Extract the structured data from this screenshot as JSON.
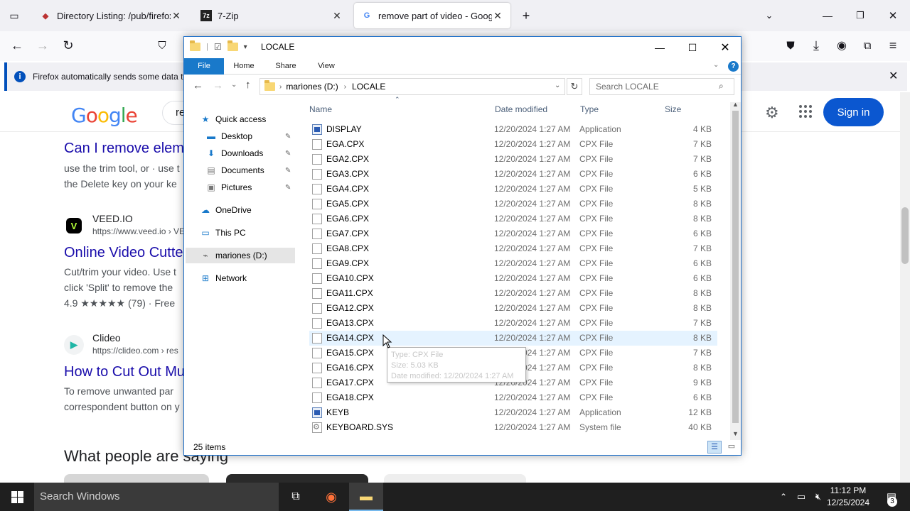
{
  "browser": {
    "tabs": [
      {
        "label": "Directory Listing: /pub/firefox/r",
        "active": false
      },
      {
        "label": "7-Zip",
        "active": false
      },
      {
        "label": "remove part of video - Google S",
        "active": true
      }
    ],
    "notice": "Firefox automatically sends some data to"
  },
  "google": {
    "logo": "Google",
    "search_fragment": "re",
    "sign_in": "Sign in",
    "results": [
      {
        "title": "Can I remove elem",
        "snippet_1": "use the trim tool, or · use t",
        "snippet_2": "the Delete key on your ke"
      },
      {
        "site": "VEED.IO",
        "url": "https://www.veed.io › VE",
        "title": "Online Video Cutte",
        "snippet_1": "Cut/trim your video. Use t",
        "snippet_2": "click 'Split' to remove the",
        "rating": "4.9 ★★★★★ (79) · Free"
      },
      {
        "site": "Clideo",
        "url": "https://clideo.com › res",
        "title": "How to Cut Out Mu",
        "snippet_1": "To remove unwanted par",
        "snippet_2": "correspondent button on y"
      }
    ],
    "people_also": "What people are saying"
  },
  "explorer": {
    "title": "LOCALE",
    "ribbon_tabs": [
      "File",
      "Home",
      "Share",
      "View"
    ],
    "path": [
      "marìones (D:)",
      "LOCALE"
    ],
    "search_placeholder": "Search LOCALE",
    "nav": {
      "quick_access": "Quick access",
      "desktop": "Desktop",
      "downloads": "Downloads",
      "documents": "Documents",
      "pictures": "Pictures",
      "onedrive": "OneDrive",
      "thispc": "This PC",
      "drive": "mariones (D:)",
      "network": "Network"
    },
    "columns": {
      "name": "Name",
      "date": "Date modified",
      "type": "Type",
      "size": "Size"
    },
    "files": [
      {
        "name": "DISPLAY",
        "date": "12/20/2024 1:27 AM",
        "type": "Application",
        "size": "4 KB"
      },
      {
        "name": "EGA.CPX",
        "date": "12/20/2024 1:27 AM",
        "type": "CPX File",
        "size": "7 KB"
      },
      {
        "name": "EGA2.CPX",
        "date": "12/20/2024 1:27 AM",
        "type": "CPX File",
        "size": "7 KB"
      },
      {
        "name": "EGA3.CPX",
        "date": "12/20/2024 1:27 AM",
        "type": "CPX File",
        "size": "6 KB"
      },
      {
        "name": "EGA4.CPX",
        "date": "12/20/2024 1:27 AM",
        "type": "CPX File",
        "size": "5 KB"
      },
      {
        "name": "EGA5.CPX",
        "date": "12/20/2024 1:27 AM",
        "type": "CPX File",
        "size": "8 KB"
      },
      {
        "name": "EGA6.CPX",
        "date": "12/20/2024 1:27 AM",
        "type": "CPX File",
        "size": "8 KB"
      },
      {
        "name": "EGA7.CPX",
        "date": "12/20/2024 1:27 AM",
        "type": "CPX File",
        "size": "6 KB"
      },
      {
        "name": "EGA8.CPX",
        "date": "12/20/2024 1:27 AM",
        "type": "CPX File",
        "size": "7 KB"
      },
      {
        "name": "EGA9.CPX",
        "date": "12/20/2024 1:27 AM",
        "type": "CPX File",
        "size": "6 KB"
      },
      {
        "name": "EGA10.CPX",
        "date": "12/20/2024 1:27 AM",
        "type": "CPX File",
        "size": "6 KB"
      },
      {
        "name": "EGA11.CPX",
        "date": "12/20/2024 1:27 AM",
        "type": "CPX File",
        "size": "8 KB"
      },
      {
        "name": "EGA12.CPX",
        "date": "12/20/2024 1:27 AM",
        "type": "CPX File",
        "size": "8 KB"
      },
      {
        "name": "EGA13.CPX",
        "date": "12/20/2024 1:27 AM",
        "type": "CPX File",
        "size": "7 KB"
      },
      {
        "name": "EGA14.CPX",
        "date": "12/20/2024 1:27 AM",
        "type": "CPX File",
        "size": "8 KB"
      },
      {
        "name": "EGA15.CPX",
        "date": "12/20/2024 1:27 AM",
        "type": "CPX File",
        "size": "7 KB"
      },
      {
        "name": "EGA16.CPX",
        "date": "12/20/2024 1:27 AM",
        "type": "CPX File",
        "size": "8 KB"
      },
      {
        "name": "EGA17.CPX",
        "date": "12/20/2024 1:27 AM",
        "type": "CPX File",
        "size": "9 KB"
      },
      {
        "name": "EGA18.CPX",
        "date": "12/20/2024 1:27 AM",
        "type": "CPX File",
        "size": "6 KB"
      },
      {
        "name": "KEYB",
        "date": "12/20/2024 1:27 AM",
        "type": "Application",
        "size": "12 KB"
      },
      {
        "name": "KEYBOARD.SYS",
        "date": "12/20/2024 1:27 AM",
        "type": "System file",
        "size": "40 KB"
      }
    ],
    "tooltip": {
      "type": "Type: CPX File",
      "size": "Size: 5.03 KB",
      "date": "Date modified: 12/20/2024 1:27 AM"
    },
    "status": "25 items"
  },
  "taskbar": {
    "search": "Search Windows",
    "time": "11:12 PM",
    "date": "12/25/2024",
    "notification_count": "3"
  },
  "colors": {
    "accent": "#1979ca",
    "google_blue": "#0b57d0",
    "link": "#1a0dab"
  }
}
